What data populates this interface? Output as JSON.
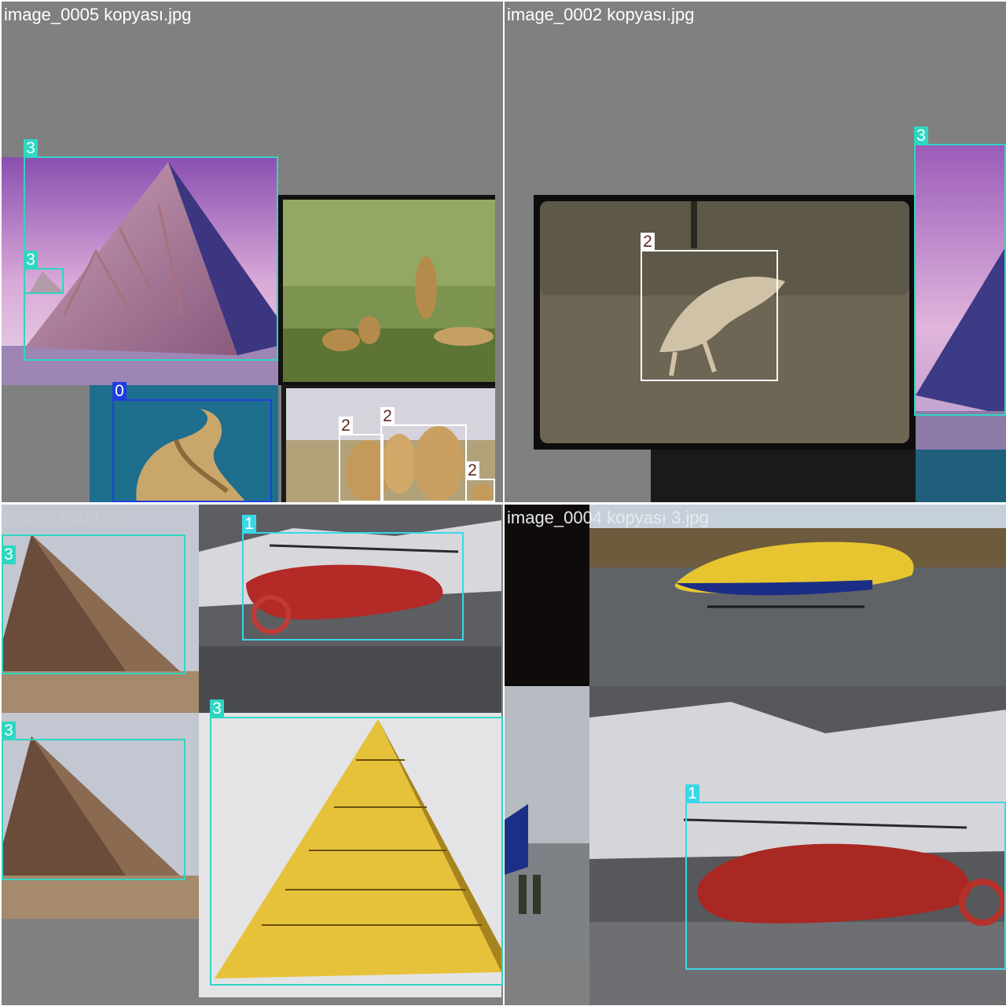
{
  "colors": {
    "class_0": "#1f3ee0",
    "class_1": "#3ad7e6",
    "class_2": "#ffffff",
    "class_3": "#2fd6c2",
    "tile_bg": "#808080",
    "filename_text": "#ffffff"
  },
  "tiles": [
    {
      "filename": "image_0005 kopyası.jpg",
      "labels": [
        "3",
        "3",
        "0",
        "2",
        "2",
        "2"
      ]
    },
    {
      "filename": "image_0002 kopyası.jpg",
      "labels": [
        "2",
        "3"
      ]
    },
    {
      "filename": "image_0003.jpg",
      "labels": [
        "3",
        "3",
        "1",
        "3"
      ]
    },
    {
      "filename": "image_0004 kopyası 3.jpg",
      "labels": [
        "1"
      ]
    }
  ]
}
